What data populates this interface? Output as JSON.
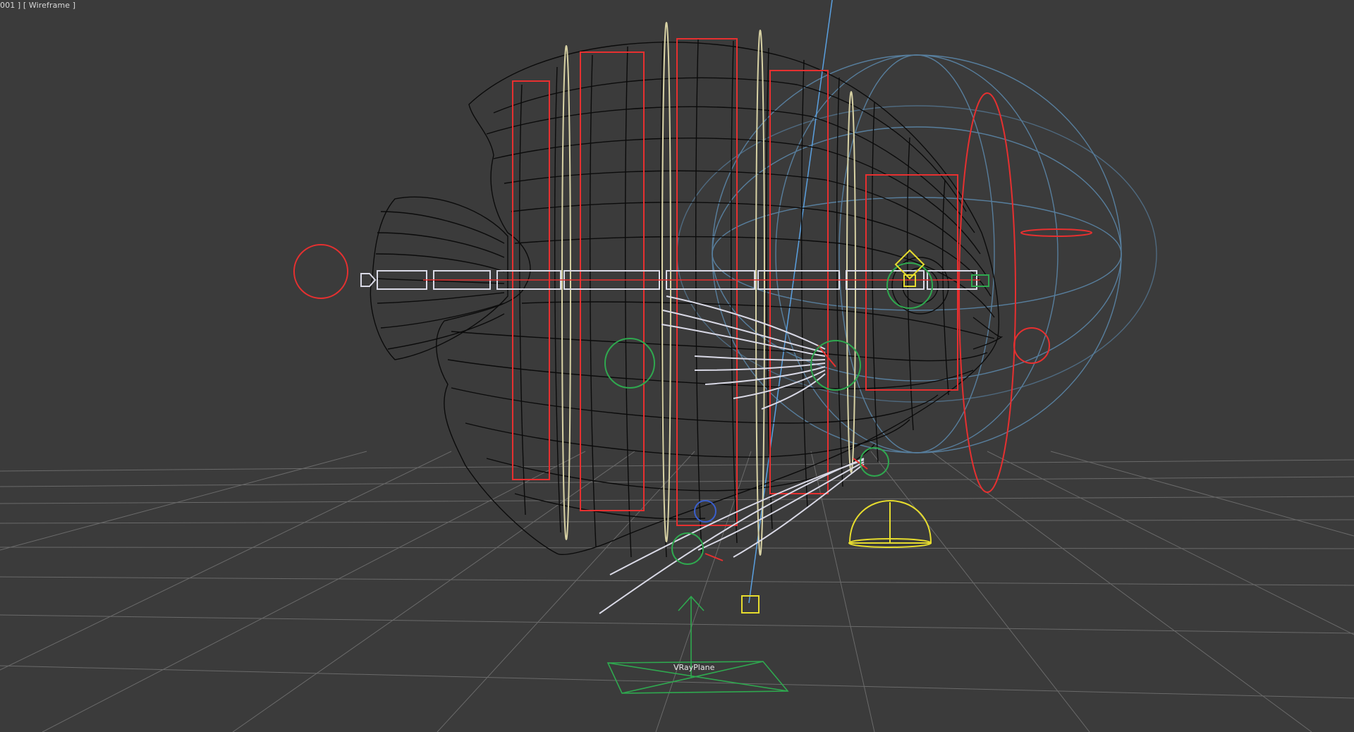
{
  "viewport": {
    "label": "001 ] [ Wireframe ]",
    "background_color": "#3b3b3b",
    "grid_color": "#6c6c6c"
  },
  "scene": {
    "plane_label": "VRayPlane",
    "colors": {
      "mesh": "#0b0b0b",
      "bone": "#d9d9e6",
      "spine_controls": "#e63030",
      "ring_controls": "#d8d2a4",
      "eye_gizmo": "#2fa84f",
      "bounding_sphere": "#5b86a8",
      "helper_yellow": "#e6dc2e",
      "vray_plane": "#2fa84f"
    }
  }
}
